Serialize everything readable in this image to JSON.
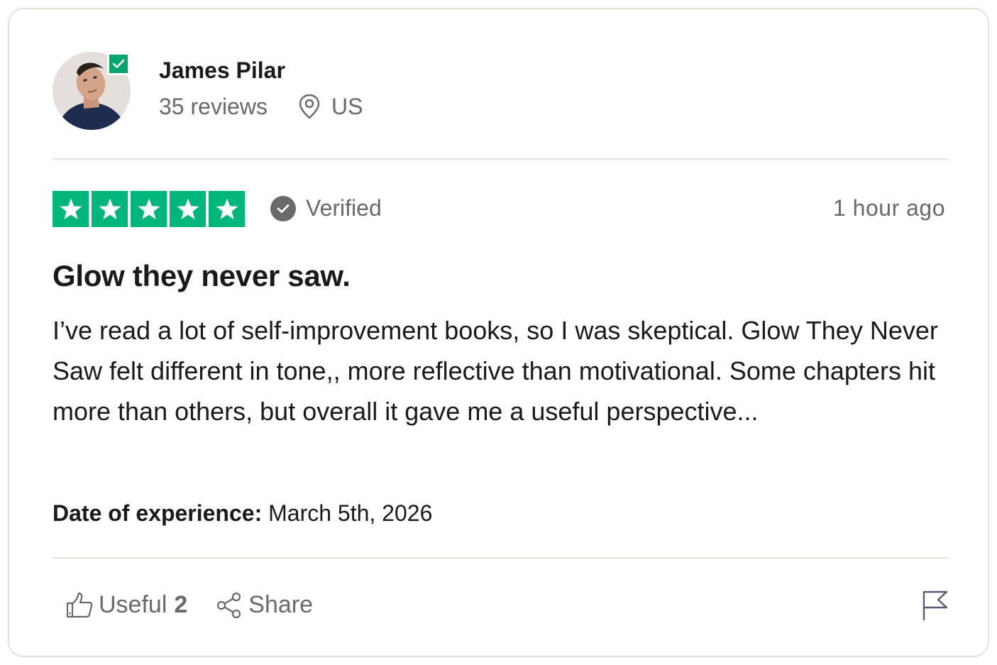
{
  "reviewer": {
    "name": "James Pilar",
    "reviews_count": "35 reviews",
    "country": "US"
  },
  "review": {
    "rating": 5,
    "max_rating": 5,
    "verified_label": "Verified",
    "time_ago": "1 hour ago",
    "title": "Glow they never saw.",
    "body": "I’ve read a lot of self-improvement books, so I was skeptical. Glow They Never Saw felt different in tone,, more reflective than motivational. Some chapters hit more than others, but overall it gave me a useful perspective...",
    "date_label": "Date of experience:",
    "date_value": "March 5th, 2026"
  },
  "actions": {
    "useful_label": "Useful",
    "useful_count": "2",
    "share_label": "Share"
  },
  "colors": {
    "star_green": "#00b67a",
    "badge_green": "#04a46b",
    "muted_text": "#696969"
  },
  "icons": [
    "verified-badge-icon",
    "location-pin-icon",
    "star-icon",
    "check-circle-icon",
    "thumbs-up-icon",
    "share-icon",
    "flag-icon"
  ]
}
